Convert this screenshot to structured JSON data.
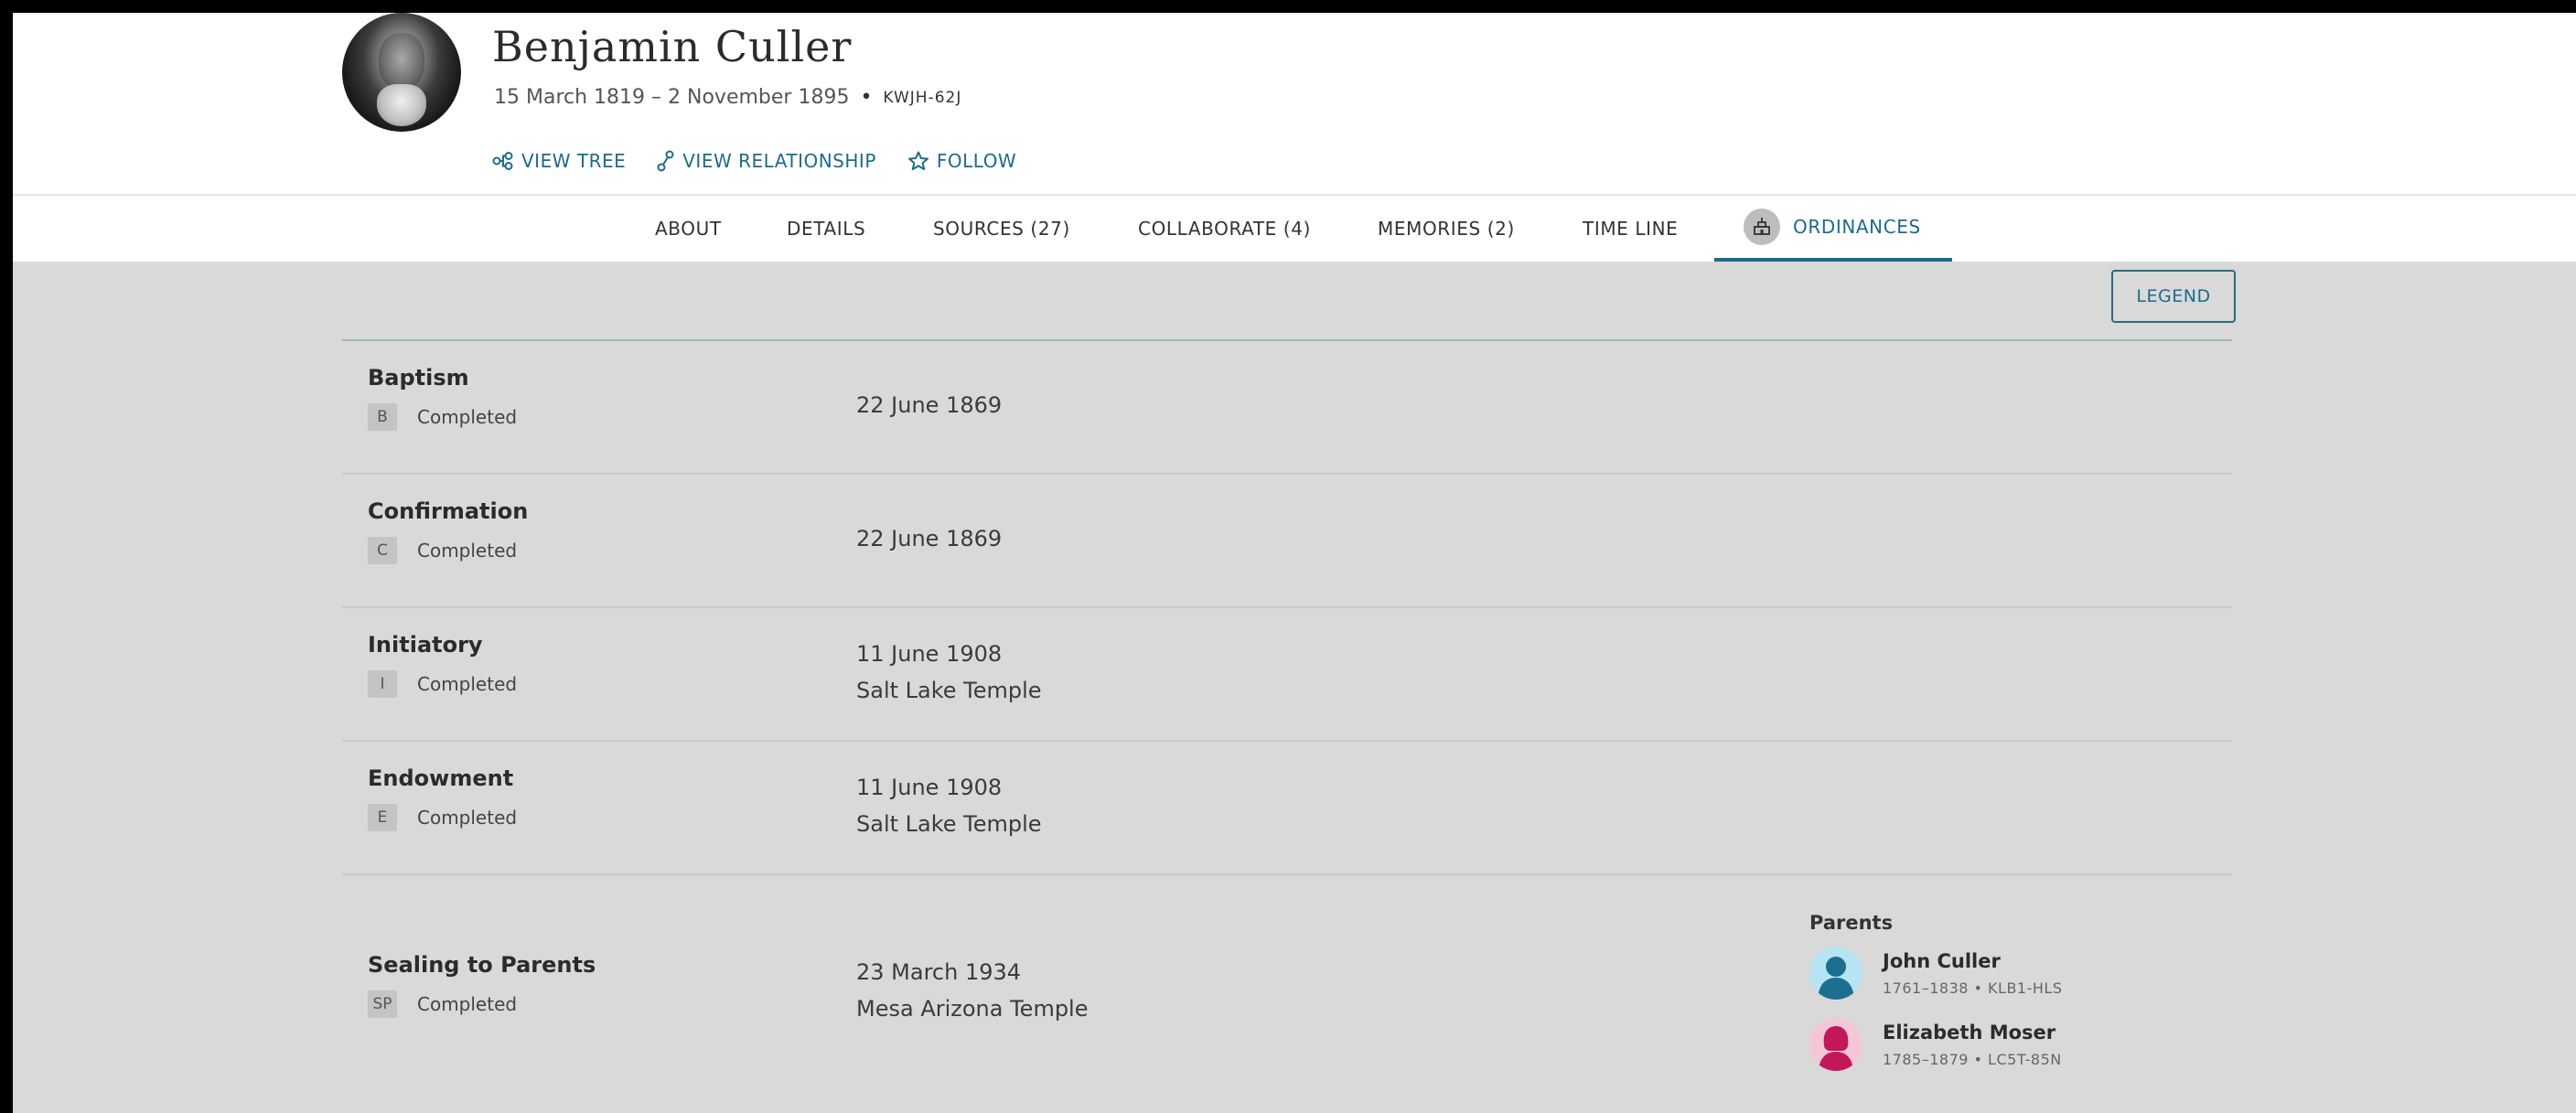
{
  "person": {
    "name": "Benjamin Culler",
    "dates": "15 March 1819 – 2 November 1895",
    "separator": "•",
    "pid": "KWJH-62J"
  },
  "actions": {
    "view_tree": "VIEW TREE",
    "view_relationship": "VIEW RELATIONSHIP",
    "follow": "FOLLOW"
  },
  "tabs": [
    {
      "label": "ABOUT"
    },
    {
      "label": "DETAILS"
    },
    {
      "label": "SOURCES (27)"
    },
    {
      "label": "COLLABORATE (4)"
    },
    {
      "label": "MEMORIES (2)"
    },
    {
      "label": "TIME LINE"
    },
    {
      "label": "ORDINANCES",
      "active": true
    }
  ],
  "legend_label": "LEGEND",
  "ordinances": [
    {
      "title": "Baptism",
      "badge": "B",
      "status": "Completed",
      "date": "22 June 1869",
      "temple": ""
    },
    {
      "title": "Confirmation",
      "badge": "C",
      "status": "Completed",
      "date": "22 June 1869",
      "temple": ""
    },
    {
      "title": "Initiatory",
      "badge": "I",
      "status": "Completed",
      "date": "11 June 1908",
      "temple": "Salt Lake Temple"
    },
    {
      "title": "Endowment",
      "badge": "E",
      "status": "Completed",
      "date": "11 June 1908",
      "temple": "Salt Lake Temple"
    },
    {
      "title": "Sealing to Parents",
      "badge": "SP",
      "status": "Completed",
      "date": "23 March 1934",
      "temple": "Mesa Arizona Temple"
    }
  ],
  "parents": {
    "heading": "Parents",
    "father": {
      "name": "John Culler",
      "meta": "1761–1838 • KLB1-HLS"
    },
    "mother": {
      "name": "Elizabeth Moser",
      "meta": "1785–1879 • LC5T-85N"
    }
  },
  "colors": {
    "accent": "#1d6b8a",
    "page_background": "#d9d9d9",
    "male_avatar": "#1c6f8f",
    "female_avatar": "#c2185b"
  }
}
